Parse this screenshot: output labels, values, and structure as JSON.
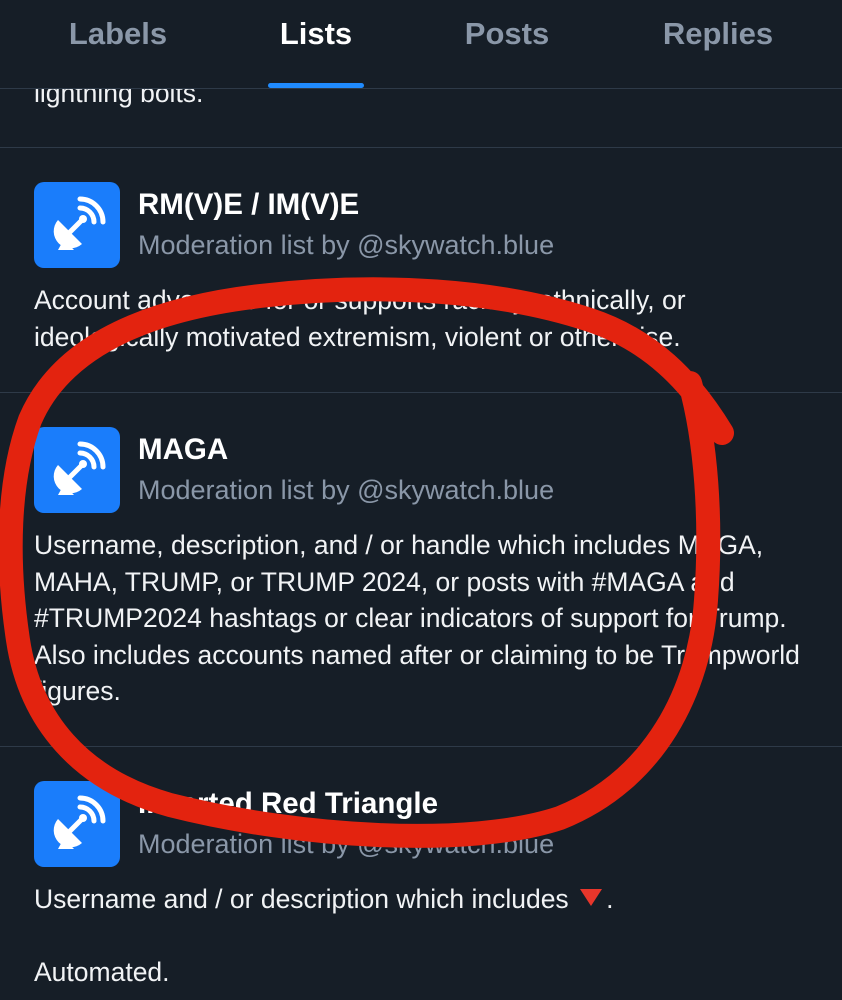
{
  "tabs": [
    {
      "label": "Labels",
      "active": false
    },
    {
      "label": "Lists",
      "active": true
    },
    {
      "label": "Posts",
      "active": false
    },
    {
      "label": "Replies",
      "active": false
    }
  ],
  "previous_item_tail": "lightning bolts.",
  "lists": [
    {
      "name": "RM(V)E / IM(V)E",
      "byline": "Moderation list by @skywatch.blue",
      "description": "Account advocates for or supports racially, ethnically, or ideologically motivated extremism, violent or otherwise.",
      "icon": "satellite-dish-icon"
    },
    {
      "name": "MAGA",
      "byline": "Moderation list by @skywatch.blue",
      "description": "Username, description, and / or handle which includes MAGA, MAHA, TRUMP, or TRUMP 2024, or posts with #MAGA and #TRUMP2024 hashtags or clear indicators of support for Trump. Also includes accounts named after or claiming to be Trumpworld figures.",
      "icon": "satellite-dish-icon"
    },
    {
      "name": "Inverted Red Triangle",
      "byline": "Moderation list by @skywatch.blue",
      "description_before_emoji": "Username and / or description which includes",
      "description_after_emoji": ".",
      "description_emoji": "red-triangle-pointed-down",
      "description_second_line": "Automated.",
      "icon": "satellite-dish-icon"
    }
  ],
  "colors": {
    "background": "#161e27",
    "accent": "#208bfe",
    "avatar": "#1a7dfb",
    "muted_text": "#8a97a8",
    "annotation_marker": "#e3230f"
  }
}
